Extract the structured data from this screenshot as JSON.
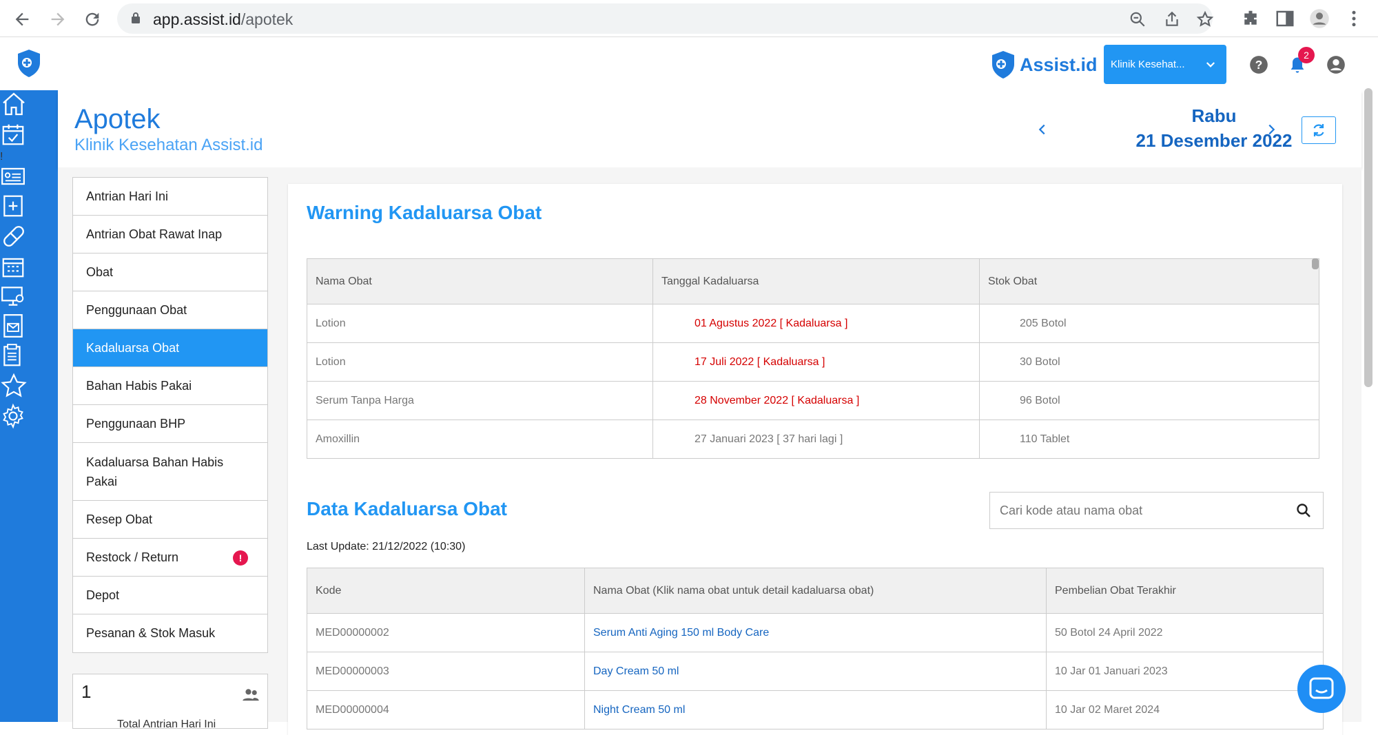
{
  "browser": {
    "url_host": "app.assist.id",
    "url_path": "/apotek"
  },
  "brand": {
    "name": "Assist.id"
  },
  "clinic_selector": {
    "label": "Klinik Kesehat..."
  },
  "notifications": {
    "count": "2"
  },
  "sidebar": {
    "alert": "!"
  },
  "page": {
    "title": "Apotek",
    "subtitle": "Klinik Kesehatan Assist.id",
    "day": "Rabu",
    "date": "21 Desember 2022"
  },
  "menu": {
    "items": [
      "Antrian Hari Ini",
      "Antrian Obat Rawat Inap",
      "Obat",
      "Penggunaan Obat",
      "Kadaluarsa Obat",
      "Bahan Habis Pakai",
      "Penggunaan BHP",
      "Kadaluarsa Bahan Habis Pakai",
      "Resep Obat",
      "Restock / Return",
      "Depot",
      "Pesanan & Stok Masuk"
    ],
    "restock_alert": "!"
  },
  "stat": {
    "value": "1",
    "label": "Total Antrian Hari Ini"
  },
  "warning": {
    "title": "Warning Kadaluarsa Obat",
    "headers": [
      "Nama Obat",
      "Tanggal Kadaluarsa",
      "Stok Obat"
    ],
    "rows": [
      [
        "Lotion",
        "01 Agustus 2022 [ Kadaluarsa ]",
        "205 Botol"
      ],
      [
        "Lotion",
        "17 Juli 2022 [ Kadaluarsa ]",
        "30 Botol"
      ],
      [
        "Serum Tanpa Harga",
        "28 November 2022 [ Kadaluarsa ]",
        "96 Botol"
      ],
      [
        "Amoxillin",
        "27 Januari 2023 [ 37 hari lagi ]",
        "110 Tablet"
      ]
    ]
  },
  "data": {
    "title": "Data Kadaluarsa Obat",
    "search_placeholder": "Cari kode atau nama obat",
    "last_update": "Last Update: 21/12/2022 (10:30)",
    "headers": [
      "Kode",
      "Nama Obat (Klik nama obat untuk detail kadaluarsa obat)",
      "Pembelian Obat Terakhir"
    ],
    "rows": [
      [
        "MED00000002",
        "Serum Anti Aging 150 ml Body Care",
        "50 Botol 24 April 2022"
      ],
      [
        "MED00000003",
        "Day Cream 50 ml",
        "10 Jar 01 Januari 2023"
      ],
      [
        "MED00000004",
        "Night Cream 50 ml",
        "10 Jar 02 Maret 2024"
      ]
    ]
  },
  "colors": {
    "primary": "#1f7bdc",
    "accent": "#2196f3",
    "danger": "#d50000",
    "badge": "#e5174f"
  }
}
